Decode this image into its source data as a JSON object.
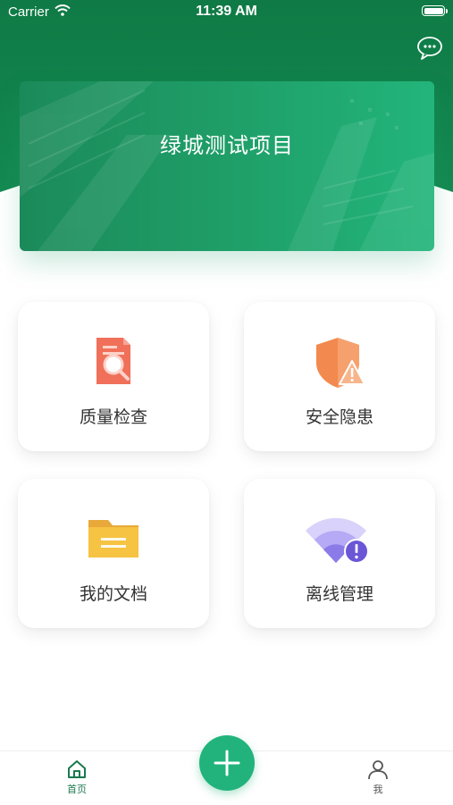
{
  "status_bar": {
    "carrier": "Carrier",
    "time": "11:39 AM",
    "battery_level": 1.0
  },
  "header": {
    "message_icon": "chat-bubble-icon"
  },
  "project": {
    "name": "绿城测试项目"
  },
  "modules": [
    {
      "label": "质量检查",
      "icon": "quality-inspection-icon"
    },
    {
      "label": "安全隐患",
      "icon": "safety-hazard-icon"
    },
    {
      "label": "我的文档",
      "icon": "folder-icon"
    },
    {
      "label": "离线管理",
      "icon": "offline-wifi-icon"
    }
  ],
  "tabbar": {
    "home_label": "首页",
    "me_label": "我",
    "add_icon": "plus-icon"
  },
  "colors": {
    "brand_green": "#1a7a4e",
    "accent_green": "#21b37b",
    "quality_red": "#f0705a",
    "safety_orange": "#f2894e",
    "folder_yellow": "#f6c343",
    "offline_purple": "#8b7be8"
  }
}
